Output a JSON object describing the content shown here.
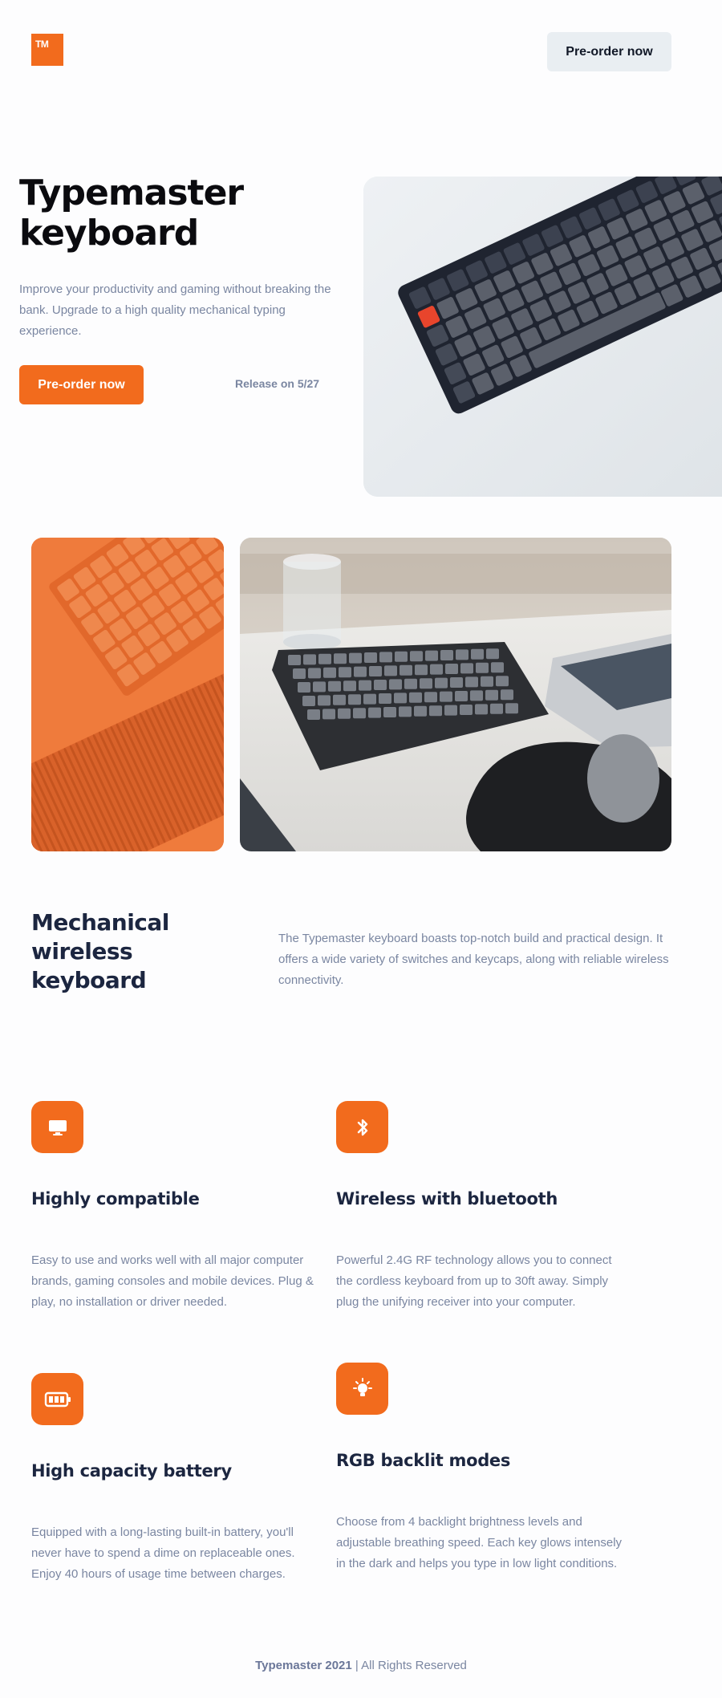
{
  "header": {
    "logo_text": "TM",
    "preorder_label": "Pre-order now"
  },
  "hero": {
    "title": "Typemaster keyboard",
    "description": "Improve your productivity and gaming without breaking the bank. Upgrade to a high quality mechanical typing experience.",
    "preorder_label": "Pre-order now",
    "release_text": "Release on 5/27"
  },
  "section": {
    "title": "Mechanical wireless keyboard",
    "description": "The Typemaster keyboard boasts top-notch build and practical design. It offers a wide variety of switches and keycaps, along with reliable wireless connectivity."
  },
  "features": [
    {
      "icon": "monitor-icon",
      "title": "Highly compatible",
      "description": "Easy to use and works well with all major computer brands, gaming consoles and mobile devices. Plug & play, no installation or driver needed."
    },
    {
      "icon": "bluetooth-icon",
      "title": "Wireless with bluetooth",
      "description": "Powerful 2.4G RF technology allows you to connect the cordless keyboard from up to 30ft away. Simply plug the unifying receiver into your computer."
    },
    {
      "icon": "battery-icon",
      "title": "High capacity battery",
      "description": "Equipped with a long-lasting built-in battery, you'll never have to spend a dime on replaceable ones. Enjoy 40 hours of usage time between charges."
    },
    {
      "icon": "lightbulb-icon",
      "title": "RGB backlit modes",
      "description": "Choose from 4 backlight brightness levels and adjustable breathing speed. Each key glows intensely in the dark and helps you type in low light conditions."
    }
  ],
  "footer": {
    "brand": "Typemaster 2021",
    "separator": " | ",
    "rights": "All Rights Reserved"
  },
  "colors": {
    "accent": "#f26b1d",
    "heading": "#1c2640",
    "muted": "#7a86a1",
    "button_light": "#e9eef2"
  }
}
